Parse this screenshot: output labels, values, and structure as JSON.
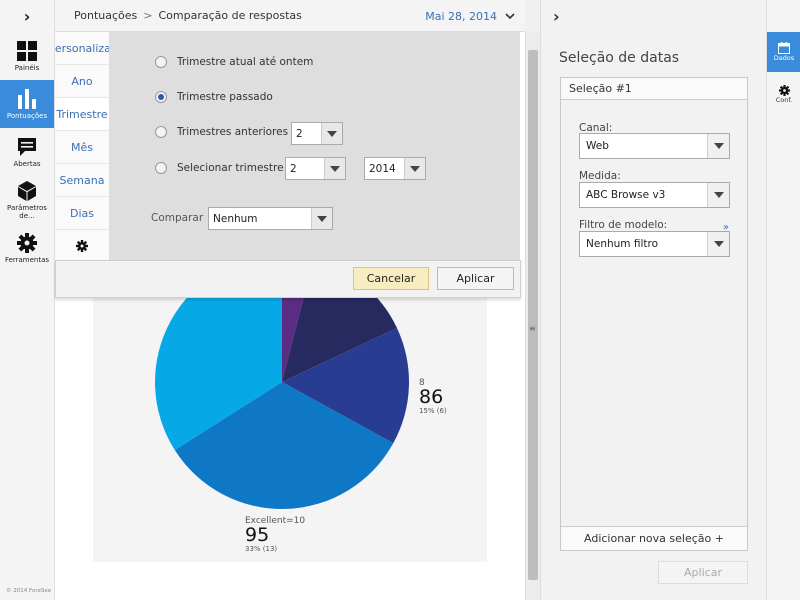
{
  "leftnav": {
    "items": [
      {
        "label": "Painéis",
        "icon": "grid-icon"
      },
      {
        "label": "Pontuações",
        "icon": "bar-chart-icon"
      },
      {
        "label": "Abertas",
        "icon": "comment-icon"
      },
      {
        "label": "Parâmetros de...",
        "icon": "cube-icon"
      },
      {
        "label": "Ferramentas",
        "icon": "gear-icon"
      }
    ],
    "copyright": "© 2014 ForeSee"
  },
  "topbar": {
    "crumb1": "Pontuações",
    "crumb_sep": ">",
    "crumb2": "Comparação de respostas",
    "date": "Mai 28, 2014"
  },
  "period_tabs": [
    "Personalizar",
    "Ano",
    "Trimestre",
    "Mês",
    "Semana",
    "Dias"
  ],
  "popover": {
    "options": [
      {
        "label": "Trimestre atual até ontem",
        "checked": false
      },
      {
        "label": "Trimestre passado",
        "checked": true
      },
      {
        "label": "Trimestres anteriores",
        "checked": false
      },
      {
        "label": "Selecionar trimestre",
        "checked": false
      }
    ],
    "prev_quarters_value": "2",
    "select_quarter_value": "2",
    "select_year_value": "2014",
    "compare_label": "Comparar",
    "compare_value": "Nenhum",
    "cancel_label": "Cancelar",
    "apply_label": "Aplicar"
  },
  "chart_data": {
    "type": "pie",
    "slices": [
      {
        "label": "",
        "value": 4,
        "color": "#5b2c83"
      },
      {
        "label": "",
        "value": 14,
        "color": "#262a5e"
      },
      {
        "label": "8",
        "value": 15,
        "color": "#283c92"
      },
      {
        "label": "Excellent=10",
        "value": 33,
        "color": "#0f78c6"
      },
      {
        "label": "",
        "value": 34,
        "color": "#06a9e6"
      }
    ],
    "label_8": {
      "name": "8",
      "score": "86",
      "pct": "15% (6)"
    },
    "label_excellent": {
      "name": "Excellent=10",
      "score": "95",
      "pct": "33% (13)"
    }
  },
  "rightpanel": {
    "title": "Seleção de datas",
    "selection_header": "Seleção #1",
    "canal_label": "Canal:",
    "canal_value": "Web",
    "medida_label": "Medida:",
    "medida_value": "ABC Browse v3",
    "filtro_label": "Filtro de modelo:",
    "filtro_more": "»",
    "filtro_value": "Nenhum filtro",
    "add_selection": "Adicionar nova seleção +",
    "apply_label": "Aplicar"
  },
  "farright": {
    "tab1": "Dados",
    "tab2": "Conf."
  }
}
